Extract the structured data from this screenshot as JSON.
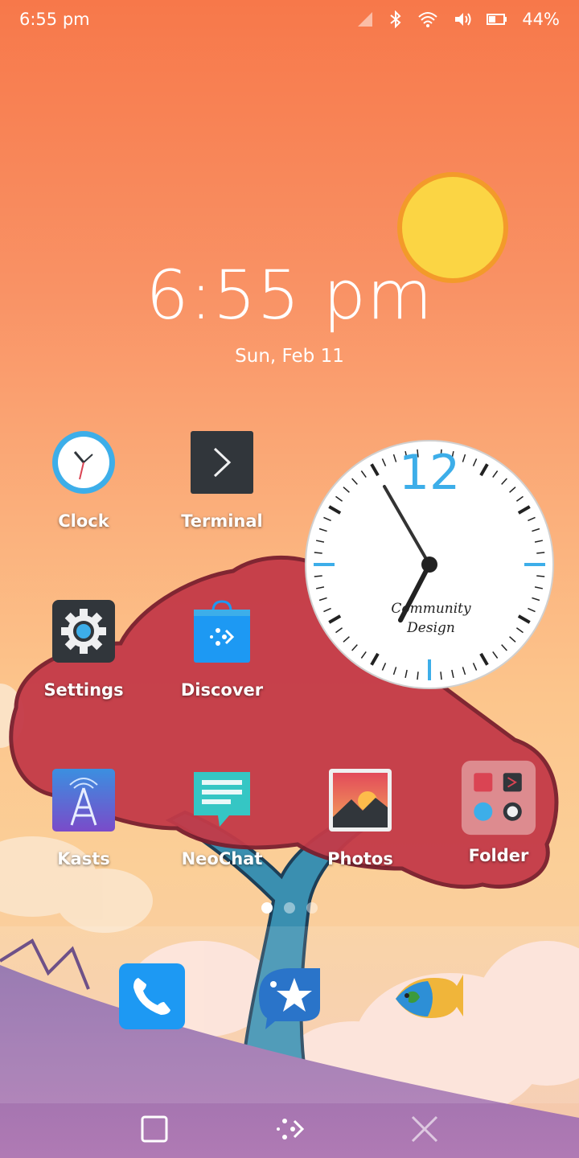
{
  "status_bar": {
    "time": "6:55 pm",
    "battery_percent": "44%",
    "icons": [
      "signal-icon",
      "bluetooth-icon",
      "wifi-icon",
      "volume-icon",
      "battery-icon"
    ]
  },
  "lock_clock": {
    "time": "6:55 pm",
    "date": "Sun, Feb 11"
  },
  "clock_widget": {
    "twelve_label": "12",
    "brand_line1": "Community",
    "brand_line2": "Design",
    "hour": 6,
    "minute": 55
  },
  "apps": [
    {
      "label": "Clock",
      "icon": "clock-icon"
    },
    {
      "label": "Terminal",
      "icon": "terminal-icon"
    },
    {
      "label": "Settings",
      "icon": "settings-gear-icon"
    },
    {
      "label": "Discover",
      "icon": "discover-bag-icon"
    },
    {
      "label": "Kasts",
      "icon": "kasts-tower-icon"
    },
    {
      "label": "NeoChat",
      "icon": "neochat-bubble-icon"
    },
    {
      "label": "Photos",
      "icon": "photos-mountain-icon"
    },
    {
      "label": "Folder",
      "icon": "folder-grid-icon"
    }
  ],
  "pager": {
    "pages": 3,
    "active": 0
  },
  "dock": [
    "phone-icon",
    "kde-connect-star-icon",
    "marble-globe-fish-icon"
  ],
  "navbar": [
    "overview-square-icon",
    "app-drawer-dots-icon",
    "close-x-icon"
  ],
  "colors": {
    "accent_blue": "#3daee9",
    "tree_red": "#c43a48",
    "trunk_blue": "#3a8fb0"
  }
}
